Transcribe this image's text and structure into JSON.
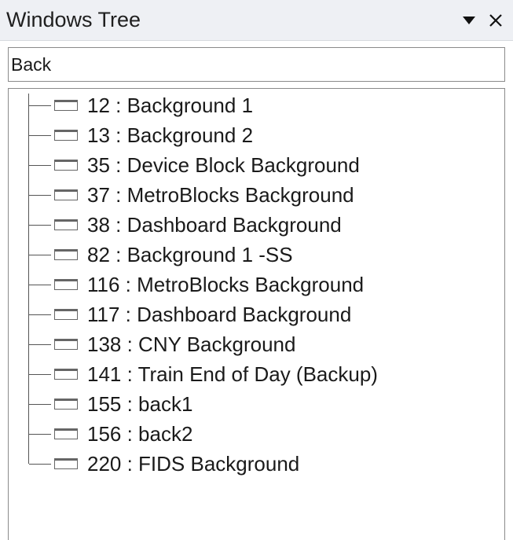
{
  "window": {
    "title": "Windows Tree",
    "dropdown_icon": "triangle-down-icon",
    "close_icon": "close-icon"
  },
  "search": {
    "value": "Back",
    "placeholder": ""
  },
  "tree": {
    "items": [
      {
        "label": "12 : Background 1"
      },
      {
        "label": "13 : Background 2"
      },
      {
        "label": "35 : Device Block Background"
      },
      {
        "label": "37 : MetroBlocks Background"
      },
      {
        "label": "38 : Dashboard Background"
      },
      {
        "label": "82 : Background 1 -SS"
      },
      {
        "label": "116 : MetroBlocks Background"
      },
      {
        "label": "117 : Dashboard Background"
      },
      {
        "label": "138 : CNY Background"
      },
      {
        "label": "141 : Train End of Day (Backup)"
      },
      {
        "label": "155 : back1"
      },
      {
        "label": "156 : back2"
      },
      {
        "label": "220 : FIDS Background"
      }
    ],
    "item_icon": "window-icon"
  }
}
